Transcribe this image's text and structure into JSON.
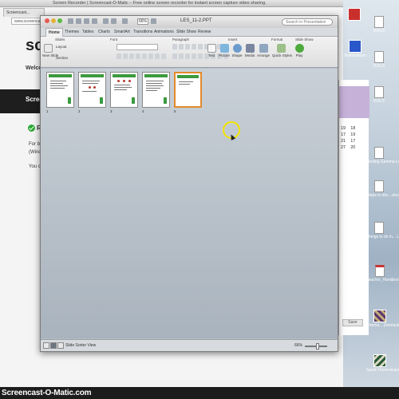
{
  "browser": {
    "title": "Screen Recorder | Screencast-O-Matic – Free online screen recorder for instant screen capture video sharing.",
    "tab_label": "Screencast...",
    "url": "www.screencas",
    "site_logo": "scre",
    "welcome": "Welcom",
    "band_text": "Screen",
    "heading": "R",
    "line1": "For be",
    "line2": "(Windo",
    "line3": "You ca"
  },
  "sheet": {
    "rows": [
      [
        "19",
        "18"
      ],
      [
        "17",
        "19"
      ],
      [
        "21",
        "17"
      ],
      [
        "27",
        "20"
      ]
    ],
    "button": "Save"
  },
  "desktop_icons": [
    {
      "name": "notifications",
      "label": "Notifications"
    },
    {
      "name": "docx-1",
      "label": "DOCX"
    },
    {
      "name": "docx-2",
      "label": "DOCX"
    },
    {
      "name": "docx-3",
      "label": "DOCX"
    },
    {
      "name": "finding-gamma",
      "label": "Finding Gamma Lo.docx"
    },
    {
      "name": "steps-docx",
      "label": "Steps to doc...docx"
    },
    {
      "name": "things-to-do",
      "label": "Things to do in... Ltd.docx"
    },
    {
      "name": "teacher-pdf",
      "label": "Teacher_Handbook_all.pdf"
    },
    {
      "name": "rhema",
      "label": "Rhema... (Kentucky).pdf"
    },
    {
      "name": "sarah",
      "label": "Sarah Domenicaning"
    }
  ],
  "ppt": {
    "zoom": "66%",
    "doc_title": "LES_11-2.PPT",
    "search_placeholder": "Search in Presentation",
    "tabs": [
      "Home",
      "Themes",
      "Tables",
      "Charts",
      "SmartArt",
      "Transitions",
      "Animations",
      "Slide Show",
      "Review"
    ],
    "groups": [
      "Slides",
      "Font",
      "Paragraph",
      "Insert",
      "Format",
      "Slide Show"
    ],
    "buttons": {
      "new_slide": "New Slide",
      "layout": "Layout",
      "section": "Section",
      "text": "Text",
      "picture": "Picture",
      "shape": "Shape",
      "media": "Media",
      "arrange": "Arrange",
      "quick_styles": "Quick Styles",
      "play": "Play"
    },
    "slides": [
      {
        "index": "1",
        "selected": false
      },
      {
        "index": "2",
        "selected": false
      },
      {
        "index": "3",
        "selected": false
      },
      {
        "index": "4",
        "selected": false
      },
      {
        "index": "5",
        "selected": true
      }
    ],
    "status_view": "Slide Sorter View",
    "status_zoom": "66%"
  },
  "footer": {
    "text": "Screencast-O-Matic.com"
  },
  "colors": {
    "accent_green": "#3c9a3e",
    "selected_slide": "#e58a2b",
    "cursor_ring": "#f4e300"
  }
}
